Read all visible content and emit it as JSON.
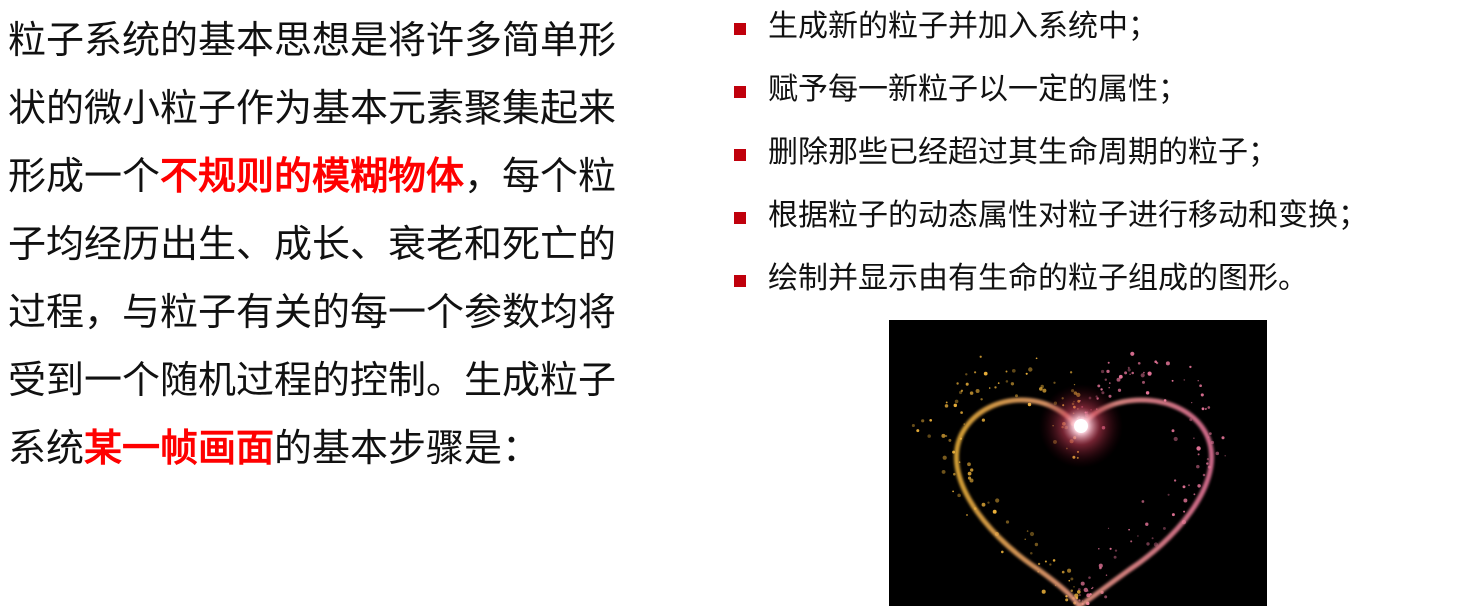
{
  "paragraph": {
    "part1": "粒子系统的基本思想是将许多简单形状的微小粒子作为基本元素聚集起来形成一个",
    "highlight1": "不规则的模糊物体",
    "part2": "，每个粒子均经历出生、成长、衰老和死亡的过程，与粒子有关的每一个参数均将受到一个随机过程的控制。生成粒子系统",
    "highlight2": "某一帧画面",
    "part3": "的基本步骤是："
  },
  "steps": [
    "生成新的粒子并加入系统中；",
    "赋予每一新粒子以一定的属性；",
    "删除那些已经超过其生命周期的粒子；",
    "根据粒子的动态属性对粒子进行移动和变换；",
    "绘制并显示由有生命的粒子组成的图形。"
  ],
  "colors": {
    "highlight": "#ff0000",
    "bullet": "#c0000c",
    "figure_background": "#000000",
    "particle_warm": "#f5b83c",
    "particle_pink": "#f07aa0"
  },
  "icons": {
    "bullet": "square-bullet-icon"
  }
}
